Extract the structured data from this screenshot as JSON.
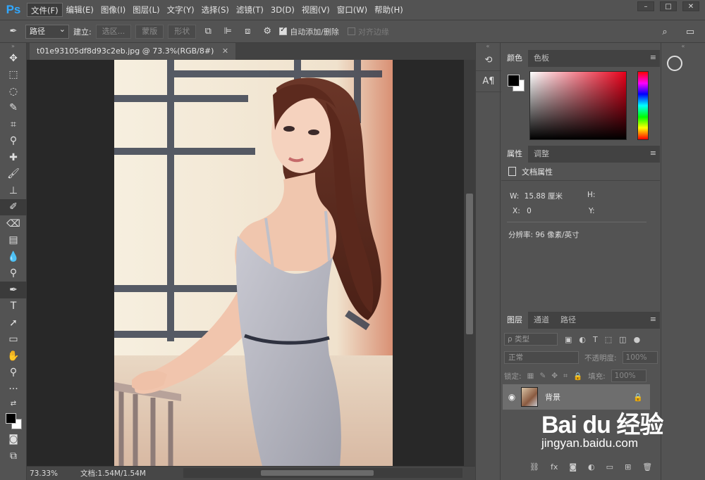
{
  "app": {
    "logo": "Ps"
  },
  "menu": [
    "文件(F)",
    "编辑(E)",
    "图像(I)",
    "图层(L)",
    "文字(Y)",
    "选择(S)",
    "滤镜(T)",
    "3D(D)",
    "视图(V)",
    "窗口(W)",
    "帮助(H)"
  ],
  "window_buttons": [
    "–",
    "□",
    "✕"
  ],
  "options": {
    "mode": "路径",
    "make_label": "建立:",
    "selection_btn": "选区...",
    "mask_btn": "蒙版",
    "shape_btn": "形状",
    "auto_add_delete": "自动添加/删除",
    "align_edges": "对齐边缘"
  },
  "document": {
    "tab_title": "t01e93105df8d93c2eb.jpg @ 73.3%(RGB/8#)",
    "close": "✕",
    "zoom": "73.33%",
    "doc_info": "文档:1.54M/1.54M"
  },
  "color_panel": {
    "tabs": [
      "颜色",
      "色板"
    ],
    "accent": "#e8001a"
  },
  "properties_panel": {
    "tabs": [
      "属性",
      "调整"
    ],
    "header": "文档属性",
    "w_label": "W:",
    "w_value": "15.88 厘米",
    "h_label": "H:",
    "x_label": "X:",
    "x_value": "0",
    "y_label": "Y:",
    "resolution": "分辨率: 96 像素/英寸"
  },
  "layers_panel": {
    "tabs": [
      "图层",
      "通道",
      "路径"
    ],
    "filter_kind": "ρ 类型",
    "blend_mode": "正常",
    "opacity_label": "不透明度:",
    "opacity_value": "100%",
    "lock_label": "锁定:",
    "fill_label": "填充:",
    "fill_value": "100%",
    "layer_name": "背景"
  },
  "watermark": {
    "logo": "Bai du 经验",
    "url": "jingyan.baidu.com"
  }
}
